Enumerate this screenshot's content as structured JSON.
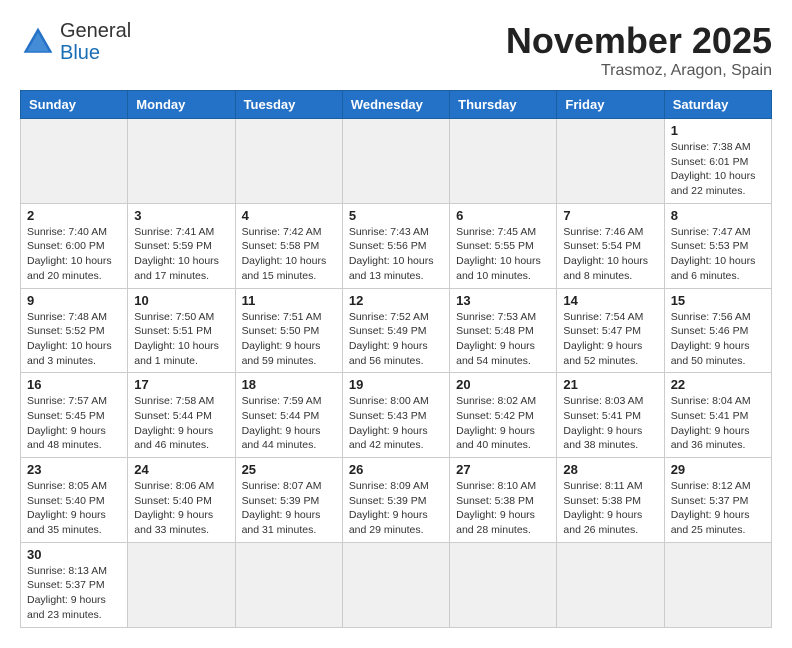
{
  "header": {
    "logo_general": "General",
    "logo_blue": "Blue",
    "month_title": "November 2025",
    "location": "Trasmoz, Aragon, Spain"
  },
  "weekdays": [
    "Sunday",
    "Monday",
    "Tuesday",
    "Wednesday",
    "Thursday",
    "Friday",
    "Saturday"
  ],
  "weeks": [
    [
      {
        "day": "",
        "info": ""
      },
      {
        "day": "",
        "info": ""
      },
      {
        "day": "",
        "info": ""
      },
      {
        "day": "",
        "info": ""
      },
      {
        "day": "",
        "info": ""
      },
      {
        "day": "",
        "info": ""
      },
      {
        "day": "1",
        "info": "Sunrise: 7:38 AM\nSunset: 6:01 PM\nDaylight: 10 hours\nand 22 minutes."
      }
    ],
    [
      {
        "day": "2",
        "info": "Sunrise: 7:40 AM\nSunset: 6:00 PM\nDaylight: 10 hours\nand 20 minutes."
      },
      {
        "day": "3",
        "info": "Sunrise: 7:41 AM\nSunset: 5:59 PM\nDaylight: 10 hours\nand 17 minutes."
      },
      {
        "day": "4",
        "info": "Sunrise: 7:42 AM\nSunset: 5:58 PM\nDaylight: 10 hours\nand 15 minutes."
      },
      {
        "day": "5",
        "info": "Sunrise: 7:43 AM\nSunset: 5:56 PM\nDaylight: 10 hours\nand 13 minutes."
      },
      {
        "day": "6",
        "info": "Sunrise: 7:45 AM\nSunset: 5:55 PM\nDaylight: 10 hours\nand 10 minutes."
      },
      {
        "day": "7",
        "info": "Sunrise: 7:46 AM\nSunset: 5:54 PM\nDaylight: 10 hours\nand 8 minutes."
      },
      {
        "day": "8",
        "info": "Sunrise: 7:47 AM\nSunset: 5:53 PM\nDaylight: 10 hours\nand 6 minutes."
      }
    ],
    [
      {
        "day": "9",
        "info": "Sunrise: 7:48 AM\nSunset: 5:52 PM\nDaylight: 10 hours\nand 3 minutes."
      },
      {
        "day": "10",
        "info": "Sunrise: 7:50 AM\nSunset: 5:51 PM\nDaylight: 10 hours\nand 1 minute."
      },
      {
        "day": "11",
        "info": "Sunrise: 7:51 AM\nSunset: 5:50 PM\nDaylight: 9 hours\nand 59 minutes."
      },
      {
        "day": "12",
        "info": "Sunrise: 7:52 AM\nSunset: 5:49 PM\nDaylight: 9 hours\nand 56 minutes."
      },
      {
        "day": "13",
        "info": "Sunrise: 7:53 AM\nSunset: 5:48 PM\nDaylight: 9 hours\nand 54 minutes."
      },
      {
        "day": "14",
        "info": "Sunrise: 7:54 AM\nSunset: 5:47 PM\nDaylight: 9 hours\nand 52 minutes."
      },
      {
        "day": "15",
        "info": "Sunrise: 7:56 AM\nSunset: 5:46 PM\nDaylight: 9 hours\nand 50 minutes."
      }
    ],
    [
      {
        "day": "16",
        "info": "Sunrise: 7:57 AM\nSunset: 5:45 PM\nDaylight: 9 hours\nand 48 minutes."
      },
      {
        "day": "17",
        "info": "Sunrise: 7:58 AM\nSunset: 5:44 PM\nDaylight: 9 hours\nand 46 minutes."
      },
      {
        "day": "18",
        "info": "Sunrise: 7:59 AM\nSunset: 5:44 PM\nDaylight: 9 hours\nand 44 minutes."
      },
      {
        "day": "19",
        "info": "Sunrise: 8:00 AM\nSunset: 5:43 PM\nDaylight: 9 hours\nand 42 minutes."
      },
      {
        "day": "20",
        "info": "Sunrise: 8:02 AM\nSunset: 5:42 PM\nDaylight: 9 hours\nand 40 minutes."
      },
      {
        "day": "21",
        "info": "Sunrise: 8:03 AM\nSunset: 5:41 PM\nDaylight: 9 hours\nand 38 minutes."
      },
      {
        "day": "22",
        "info": "Sunrise: 8:04 AM\nSunset: 5:41 PM\nDaylight: 9 hours\nand 36 minutes."
      }
    ],
    [
      {
        "day": "23",
        "info": "Sunrise: 8:05 AM\nSunset: 5:40 PM\nDaylight: 9 hours\nand 35 minutes."
      },
      {
        "day": "24",
        "info": "Sunrise: 8:06 AM\nSunset: 5:40 PM\nDaylight: 9 hours\nand 33 minutes."
      },
      {
        "day": "25",
        "info": "Sunrise: 8:07 AM\nSunset: 5:39 PM\nDaylight: 9 hours\nand 31 minutes."
      },
      {
        "day": "26",
        "info": "Sunrise: 8:09 AM\nSunset: 5:39 PM\nDaylight: 9 hours\nand 29 minutes."
      },
      {
        "day": "27",
        "info": "Sunrise: 8:10 AM\nSunset: 5:38 PM\nDaylight: 9 hours\nand 28 minutes."
      },
      {
        "day": "28",
        "info": "Sunrise: 8:11 AM\nSunset: 5:38 PM\nDaylight: 9 hours\nand 26 minutes."
      },
      {
        "day": "29",
        "info": "Sunrise: 8:12 AM\nSunset: 5:37 PM\nDaylight: 9 hours\nand 25 minutes."
      }
    ],
    [
      {
        "day": "30",
        "info": "Sunrise: 8:13 AM\nSunset: 5:37 PM\nDaylight: 9 hours\nand 23 minutes."
      },
      {
        "day": "",
        "info": ""
      },
      {
        "day": "",
        "info": ""
      },
      {
        "day": "",
        "info": ""
      },
      {
        "day": "",
        "info": ""
      },
      {
        "day": "",
        "info": ""
      },
      {
        "day": "",
        "info": ""
      }
    ]
  ]
}
